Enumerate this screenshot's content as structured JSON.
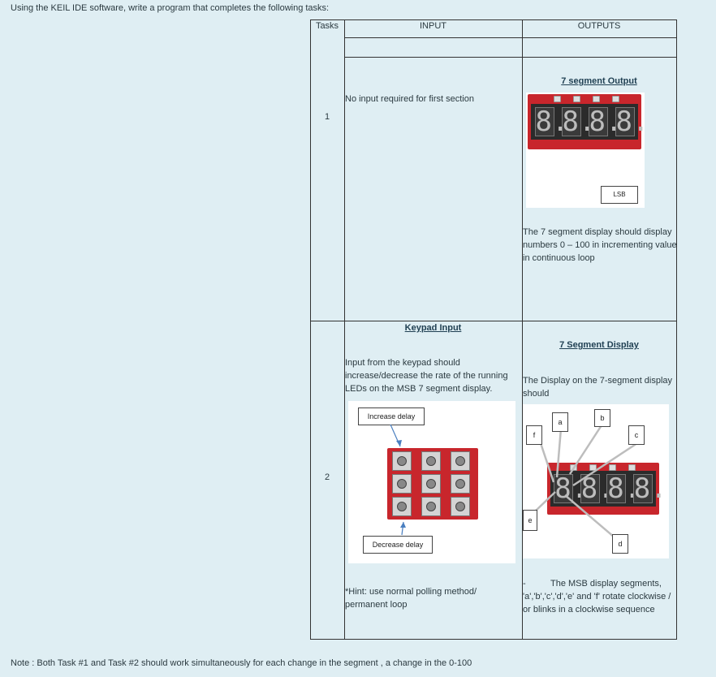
{
  "intro": "Using the KEIL IDE software, write a program that completes the following tasks:",
  "table": {
    "headers": [
      "Tasks",
      "INPUT",
      "OUTPUTS"
    ],
    "rows": [
      {
        "task": "1",
        "input_text": "No input required for first section",
        "output_title": "7 segment Output",
        "display_digits": [
          "8.",
          "8.",
          "8.",
          "8."
        ],
        "lsb_label": "LSB",
        "output_text": " The 7 segment display should display numbers 0 – 100 in incrementing value in continuous loop"
      },
      {
        "task": "2",
        "input_title": "Keypad Input",
        "input_text": "Input from the keypad should increase/decrease the rate of the running LEDs on the MSB 7 segment display.",
        "increase_label": "Increase delay",
        "decrease_label": "Decrease delay",
        "hint": "*Hint: use normal polling method/ permanent loop",
        "output_title": "7 Segment Display",
        "output_text": "The Display on the 7-segment display should",
        "segment_labels": [
          "a",
          "b",
          "c",
          "d",
          "e",
          "f"
        ],
        "output_desc_dash": "-",
        "output_desc": "The MSB display segments, 'a','b','c','d','e' and 'f' rotate clockwise / or blinks in a clockwise sequence"
      }
    ]
  },
  "note": "Note : Both Task #1 and Task #2 should work simultaneously for each change in the segment , a change in the 0-100"
}
